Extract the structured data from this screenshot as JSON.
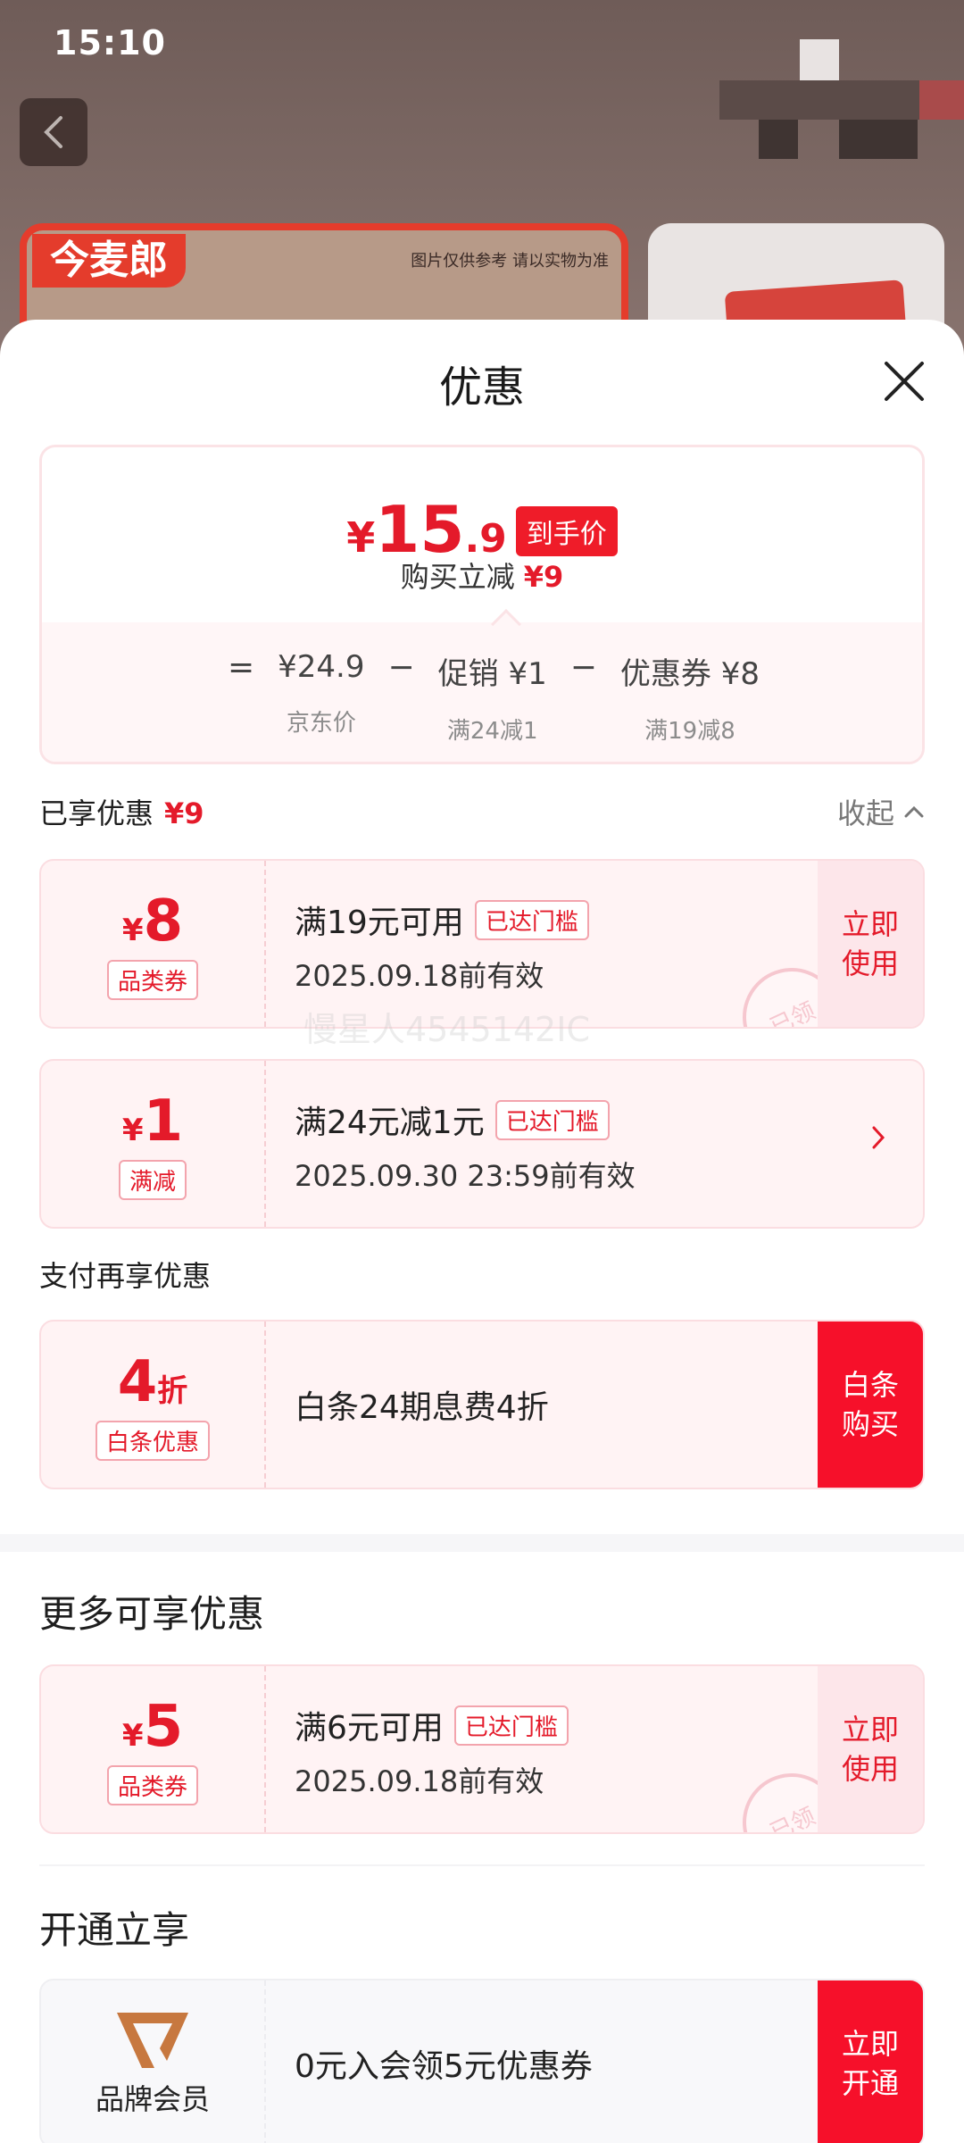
{
  "status_bar": {
    "time": "15:10"
  },
  "background": {
    "product_brand": "今麦郎",
    "product_note": "图片仅供参考 请以实物为准"
  },
  "sheet": {
    "title": "优惠",
    "summary": {
      "yen": "¥",
      "price_int": "15",
      "price_dec": ".9",
      "hand_tag": "到手价",
      "save_label": "购买立减",
      "save_value": "¥9",
      "formula": {
        "eq": "=",
        "base_value": "¥24.9",
        "base_label": "京东价",
        "op1": "−",
        "promo_value": "促销 ¥1",
        "promo_label": "满24减1",
        "op2": "−",
        "coupon_value": "优惠券 ¥8",
        "coupon_label": "满19减8"
      }
    },
    "enjoyed": {
      "title": "已享优惠",
      "value": "¥9",
      "collapse_label": "收起"
    },
    "watermark": "慢星人4545142IC",
    "coupons_enjoyed": [
      {
        "sym": "¥",
        "num": "8",
        "tag": "品类券",
        "line1": "满19元可用",
        "badge": "已达门槛",
        "line2": "2025.09.18前有效",
        "action": "立即使用",
        "stamp": "已领"
      },
      {
        "sym": "¥",
        "num": "1",
        "tag": "满减",
        "line1": "满24元减1元",
        "badge": "已达门槛",
        "line2": "2025.09.30 23:59前有效"
      }
    ],
    "pay_section": {
      "title": "支付再享优惠",
      "num": "4",
      "unit": "折",
      "tag": "白条优惠",
      "desc": "白条24期息费4折",
      "action": "白条购买"
    },
    "more": {
      "title": "更多可享优惠",
      "coupon": {
        "sym": "¥",
        "num": "5",
        "tag": "品类券",
        "line1": "满6元可用",
        "badge": "已达门槛",
        "line2": "2025.09.18前有效",
        "action": "立即使用",
        "stamp": "已领"
      }
    },
    "open": {
      "title": "开通立享",
      "member_label": "品牌会员",
      "desc": "0元入会领5元优惠券",
      "action": "立即开通"
    }
  },
  "colors": {
    "accent": "#e41a2a",
    "action_red": "#f6102a",
    "coupon_bg": "#fff3f4"
  },
  "icons": {
    "back": "chevron-left-icon",
    "close": "close-icon",
    "collapse": "chevron-up-icon",
    "detail": "chevron-right-icon"
  }
}
